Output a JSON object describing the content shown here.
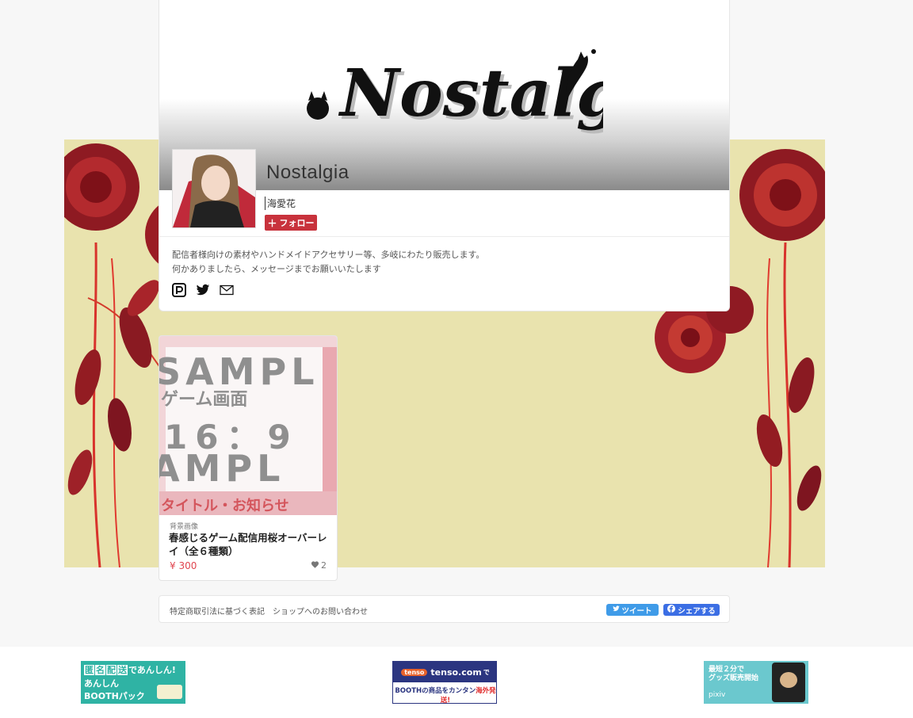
{
  "shop": {
    "logo_text": "Nostalgia",
    "name": "Nostalgia",
    "owner": "海愛花",
    "follow_label": "フォロー",
    "description": [
      "配信者様向けの素材やハンドメイドアクセサリー等、多岐にわたり販売します。",
      "何かありましたら、メッセージまでお願いいたします"
    ],
    "social_icons": [
      "pixiv-fanbox-icon",
      "twitter-icon",
      "mail-icon"
    ]
  },
  "items": [
    {
      "category": "背景画像",
      "title": "春感じるゲーム配信用桜オーバーレイ（全６種類）",
      "price": "¥ 300",
      "likes": "2",
      "thumb_text": {
        "sample1": "SAMPL",
        "game": "ゲーム画面",
        "ratio": "16：9",
        "sample2": "AMPL",
        "notice": "タイトル・お知らせ"
      }
    }
  ],
  "footer": {
    "legal_link": "特定商取引法に基づく表記",
    "contact_link": "ショップへのお問い合わせ",
    "tweet_label": "ツイート",
    "share_label": "シェアする"
  },
  "ads": {
    "ad1": {
      "line1_chars": [
        "匿",
        "名",
        "配",
        "送"
      ],
      "line1_suffix": "であんしん!",
      "line2": "あんしん",
      "line3": "BOOTHパック"
    },
    "ad2": {
      "brand": "tenso.com",
      "brand_suffix": "で",
      "tag": "tenso",
      "line": "BOOTHの商品をカンタン",
      "line_red": "海外発送!"
    },
    "ad3": {
      "line1": "最短２分で",
      "line2": "グッズ販売開始",
      "line3": "pixiv"
    }
  },
  "colors": {
    "accent": "#c8323c",
    "price": "#e0454f",
    "background_art": "#e9e3ae",
    "rose": "#a51c24",
    "tweet": "#3f9be8",
    "facebook": "#3b6ee4"
  }
}
